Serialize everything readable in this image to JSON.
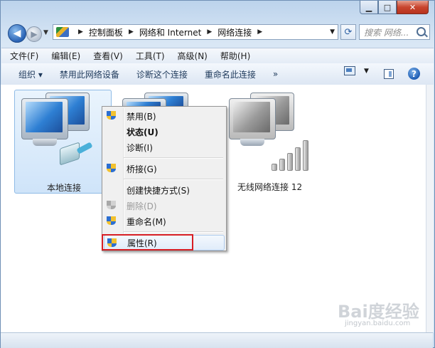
{
  "navigation": {
    "address": {
      "crumbs": [
        "控制面板",
        "网络和 Internet",
        "网络连接"
      ]
    },
    "search_placeholder": "搜索 网络..."
  },
  "menubar": {
    "items": [
      "文件(F)",
      "编辑(E)",
      "查看(V)",
      "工具(T)",
      "高级(N)",
      "帮助(H)"
    ]
  },
  "command_bar": {
    "organize": "组织 ▾",
    "disable_device": "禁用此网络设备",
    "diagnose": "诊断这个连接",
    "rename": "重命名此连接",
    "more": "»"
  },
  "connections": [
    {
      "label": "本地连接",
      "icon": "network-computer-icon"
    },
    {
      "label": "无线网络连接 12",
      "icon": "wireless-computer-icon"
    }
  ],
  "context_menu": {
    "items": [
      {
        "label": "禁用(B)",
        "shield": true,
        "bold": false,
        "disabled": false
      },
      {
        "label": "状态(U)",
        "shield": false,
        "bold": true,
        "disabled": false
      },
      {
        "label": "诊断(I)",
        "shield": false,
        "bold": false,
        "disabled": false
      },
      {
        "label": "桥接(G)",
        "shield": true,
        "bold": false,
        "disabled": false
      },
      {
        "label": "创建快捷方式(S)",
        "shield": false,
        "bold": false,
        "disabled": false
      },
      {
        "label": "删除(D)",
        "shield": true,
        "bold": false,
        "disabled": true
      },
      {
        "label": "重命名(M)",
        "shield": true,
        "bold": false,
        "disabled": false
      },
      {
        "label": "属性(R)",
        "shield": true,
        "bold": false,
        "disabled": false,
        "highlighted": true
      }
    ],
    "highlight_color": "#d71e24"
  },
  "watermark": {
    "text": "Bai度经验",
    "sub": "jingyan.baidu.com"
  }
}
